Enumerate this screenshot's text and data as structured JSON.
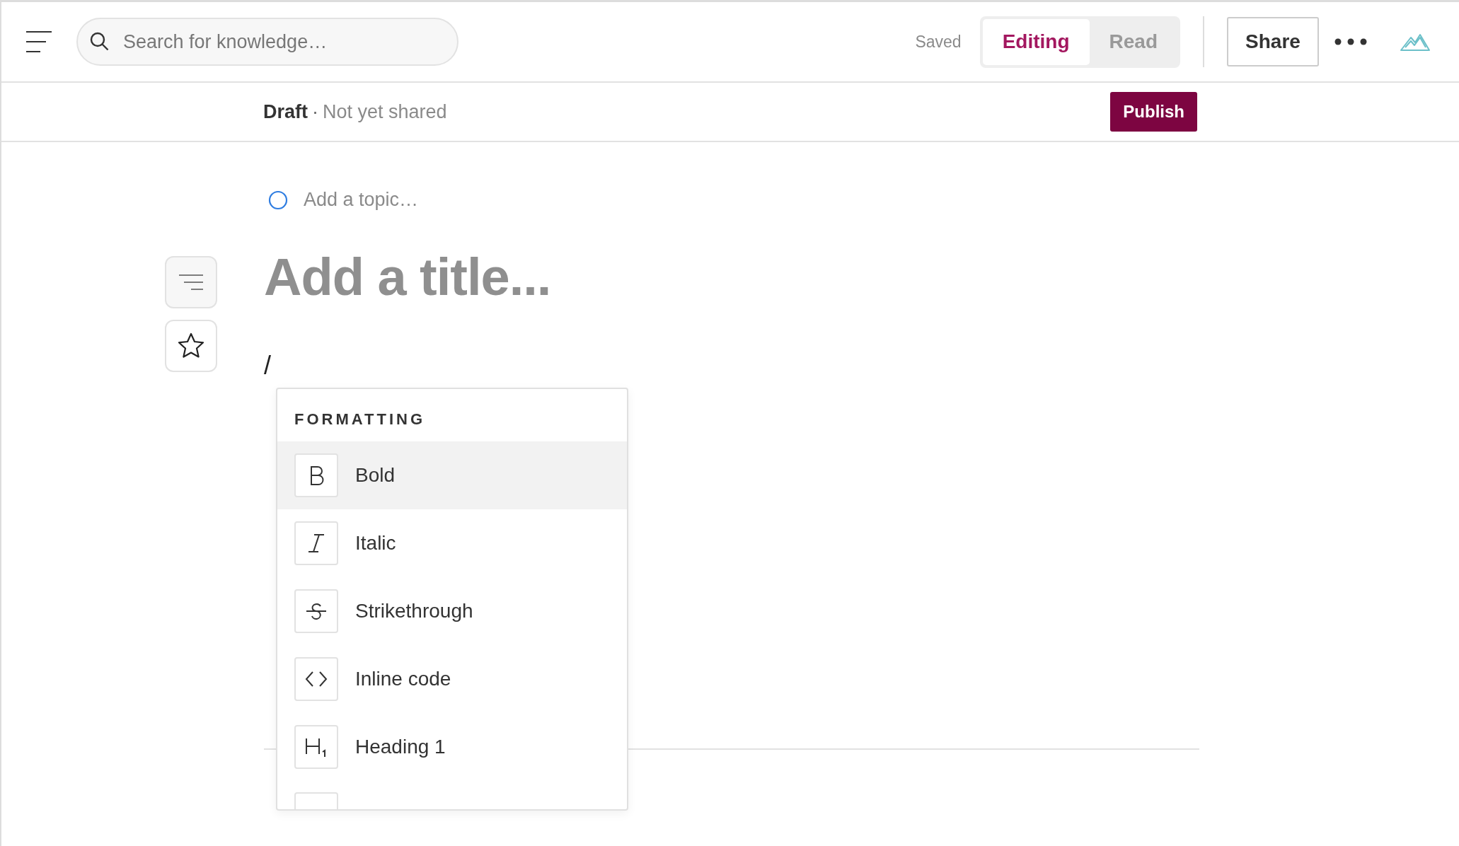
{
  "search": {
    "placeholder": "Search for knowledge…"
  },
  "save_status": "Saved",
  "mode_tabs": [
    {
      "label": "Editing",
      "selected": true
    },
    {
      "label": "Read",
      "selected": false
    }
  ],
  "share_button": "Share",
  "status_bar": {
    "state": "Draft",
    "separator": "·",
    "sharing": "Not yet shared",
    "publish_button": "Publish"
  },
  "topic": {
    "placeholder": "Add a topic…"
  },
  "title": {
    "placeholder": "Add a title..."
  },
  "body": {
    "value": "/"
  },
  "command_menu": {
    "heading": "FORMATTING",
    "items": [
      {
        "kind": "bold",
        "label": "Bold",
        "selected": true
      },
      {
        "kind": "italic",
        "label": "Italic",
        "selected": false
      },
      {
        "kind": "strikethrough",
        "label": "Strikethrough",
        "selected": false
      },
      {
        "kind": "code",
        "label": "Inline code",
        "selected": false
      },
      {
        "kind": "heading",
        "label": "Heading 1",
        "selected": false
      }
    ]
  }
}
